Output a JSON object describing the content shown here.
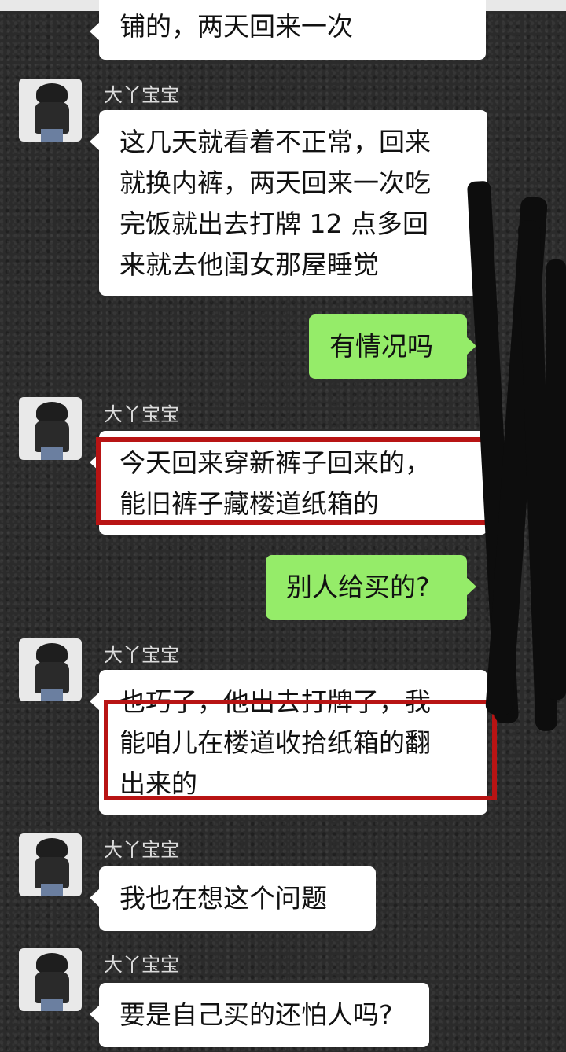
{
  "contact": {
    "name": "大丫宝宝"
  },
  "messages": [
    {
      "id": "m0",
      "side": "in",
      "text": "铺的，两天回来一次"
    },
    {
      "id": "m1",
      "side": "in",
      "text": "这几天就看着不正常，回来\n就换内裤，两天回来一次吃\n完饭就出去打牌 12 点多回\n来就去他闺女那屋睡觉"
    },
    {
      "id": "m2",
      "side": "out",
      "text": "有情况吗"
    },
    {
      "id": "m3",
      "side": "in",
      "text": "今天回来穿新裤子回来的，\n能旧裤子藏楼道纸箱的"
    },
    {
      "id": "m4",
      "side": "out",
      "text": "别人给买的?"
    },
    {
      "id": "m5",
      "side": "in",
      "text": "也巧了，他出去打牌了，我\n能咱儿在楼道收拾纸箱的翻\n出来的"
    },
    {
      "id": "m6",
      "side": "in",
      "text": "我也在想这个问题"
    },
    {
      "id": "m7",
      "side": "in",
      "text": "要是自己买的还怕人吗?"
    }
  ],
  "colors": {
    "incoming_bubble": "#ffffff",
    "outgoing_bubble": "#95ec69",
    "highlight": "#b81414"
  },
  "icons": {
    "avatar": "avatar-icon"
  }
}
